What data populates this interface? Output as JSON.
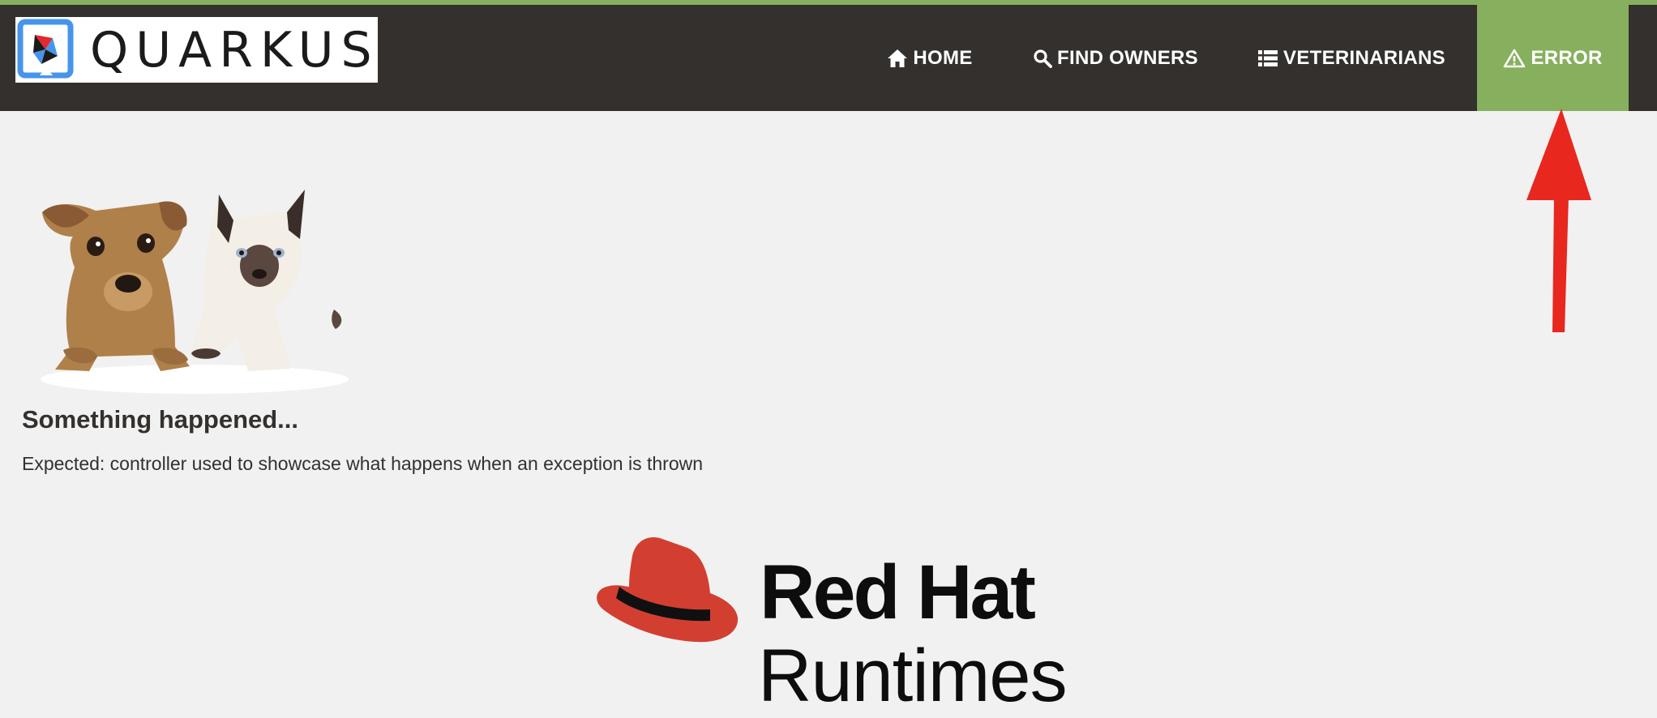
{
  "brand": {
    "name": "QUARKUS",
    "logo_icon": "quarkus-logo-icon"
  },
  "nav": {
    "items": [
      {
        "label": "HOME",
        "icon": "home-icon"
      },
      {
        "label": "FIND OWNERS",
        "icon": "search-icon"
      },
      {
        "label": "VETERINARIANS",
        "icon": "list-icon"
      },
      {
        "label": "ERROR",
        "icon": "warning-icon",
        "active": true
      }
    ]
  },
  "content": {
    "image": "pets-illustration",
    "heading": "Something happened...",
    "message": "Expected: controller used to showcase what happens when an exception is thrown"
  },
  "footer_logo": {
    "line1": "Red Hat",
    "line2": "Runtimes",
    "icon": "red-hat-logo-icon"
  },
  "annotation": {
    "icon": "red-arrow-icon"
  },
  "colors": {
    "navbar": "#34302d",
    "accent_green": "#86b05d",
    "page_bg": "#f1f1f1",
    "text": "#34302d",
    "redhat_red": "#d23f31",
    "arrow_red": "#e8271f"
  }
}
